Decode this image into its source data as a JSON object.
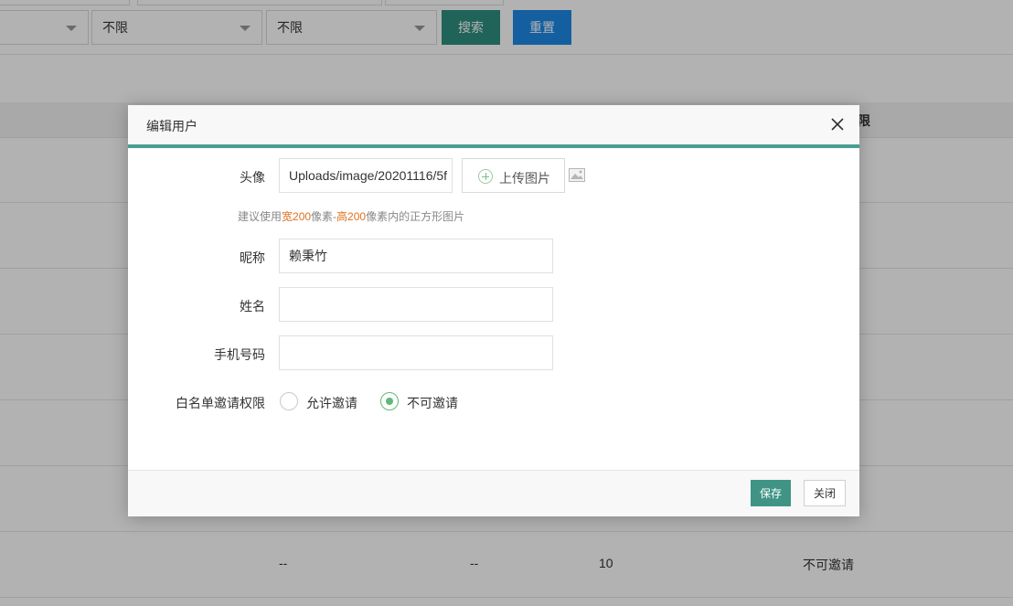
{
  "filters": {
    "select1_value": "",
    "select2_value": "不限",
    "select3_value": "不限",
    "search_label": "搜索",
    "reset_label": "重置"
  },
  "table": {
    "header_partial": "限",
    "last_row": [
      "--",
      "--",
      "10",
      "不可邀请"
    ]
  },
  "modal": {
    "title": "编辑用户",
    "avatar_label": "头像",
    "avatar_value": "Uploads/image/20201116/5f",
    "upload_label": "上传图片",
    "hint": {
      "prefix": "建议使用",
      "w_label": "宽200",
      "mid": "像素-",
      "h_label": "高200",
      "suffix": "像素内的正方形图片"
    },
    "nickname_label": "昵称",
    "nickname_value": "赖秉竹",
    "name_label": "姓名",
    "name_value": "",
    "phone_label": "手机号码",
    "phone_value": "",
    "whitelist_label": "白名单邀请权限",
    "whitelist_options": [
      "允许邀请",
      "不可邀请"
    ],
    "whitelist_selected": "不可邀请",
    "save_label": "保存",
    "close_label": "关闭"
  },
  "colors": {
    "accent_teal": "#2f8e80",
    "accent_blue": "#1e88e5",
    "radio_green": "#5fb878",
    "hint_orange": "#e0701e"
  },
  "icons": [
    "caret-down-icon",
    "close-icon",
    "plus-circle-icon",
    "image-icon"
  ]
}
